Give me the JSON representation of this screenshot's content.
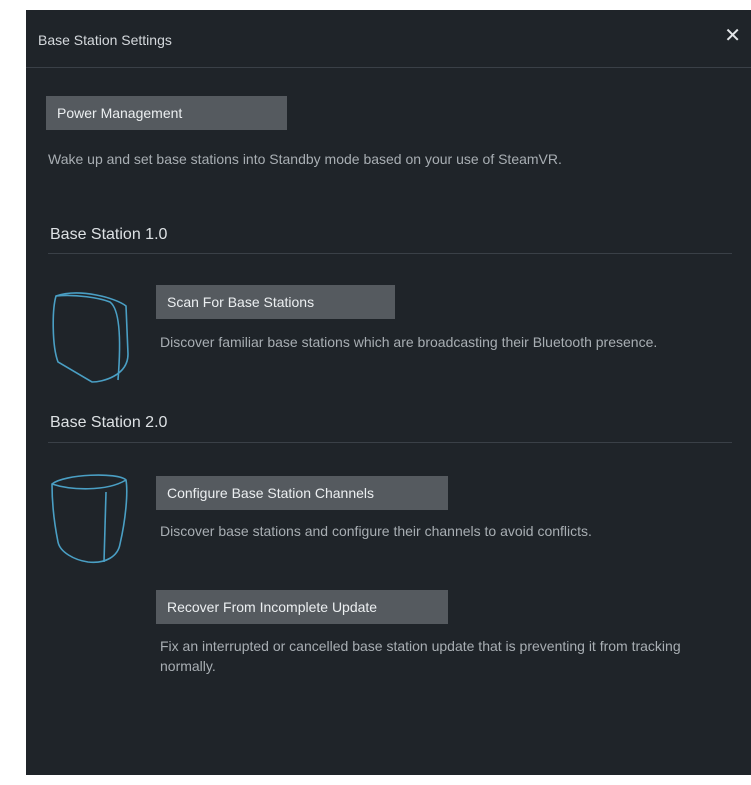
{
  "window": {
    "title": "Base Station Settings",
    "close_label": "✕"
  },
  "power": {
    "button_label": "Power Management",
    "description": "Wake up and set base stations into Standby mode based on your use of SteamVR."
  },
  "bs1": {
    "heading": "Base Station 1.0",
    "scan_label": "Scan For Base Stations",
    "scan_description": "Discover familiar base stations which are broadcasting their Bluetooth presence."
  },
  "bs2": {
    "heading": "Base Station 2.0",
    "configure_label": "Configure Base Station Channels",
    "configure_description": "Discover base stations and configure their channels to avoid conflicts.",
    "recover_label": "Recover From Incomplete Update",
    "recover_description": "Fix an interrupted or cancelled base station update that is preventing it from tracking normally."
  },
  "icons": {
    "bs1": "base-station-1-icon",
    "bs2": "base-station-2-icon",
    "close": "close-icon"
  },
  "colors": {
    "background": "#1f2429",
    "button": "#555a5f",
    "icon_stroke": "#4a9fc4"
  }
}
